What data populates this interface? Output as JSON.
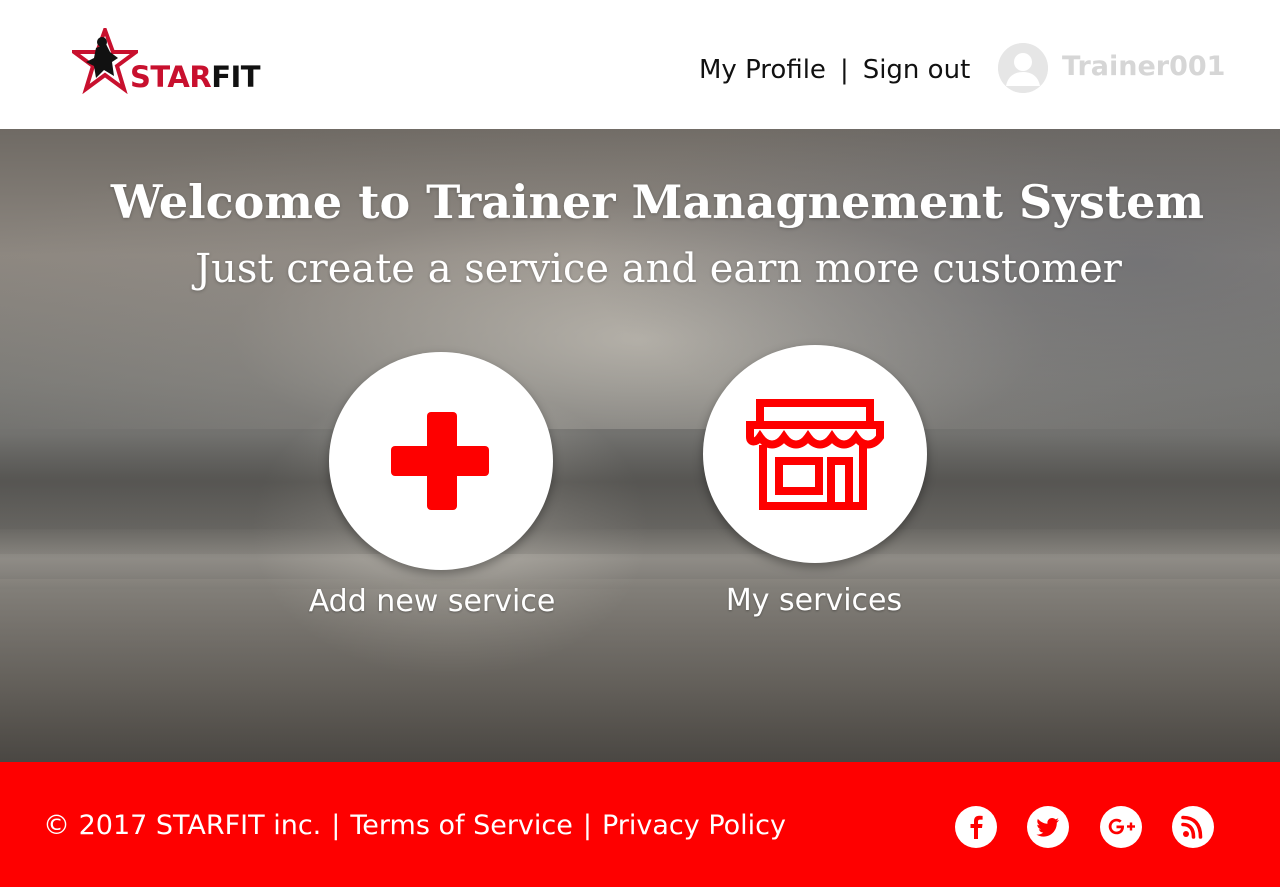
{
  "header": {
    "logo_text_star": "STAR",
    "logo_text_fit": "FIT",
    "nav": {
      "profile": "My Profile",
      "separator": "|",
      "signout": "Sign out"
    },
    "username": "Trainer001"
  },
  "hero": {
    "title": "Welcome to Trainer Managnement System",
    "subtitle": "Just create a service and earn more customer",
    "actions": [
      {
        "label": "Add new service",
        "icon": "plus-icon"
      },
      {
        "label": "My services",
        "icon": "store-icon"
      }
    ]
  },
  "footer": {
    "copyright": "© 2017 STARFIT inc.",
    "separator": "|",
    "terms": "Terms of Service",
    "privacy": "Privacy Policy",
    "social": [
      "facebook-icon",
      "twitter-icon",
      "google-plus-icon",
      "rss-icon"
    ]
  },
  "colors": {
    "brand_red": "#fe0000",
    "logo_red": "#c8102e",
    "white": "#ffffff"
  }
}
